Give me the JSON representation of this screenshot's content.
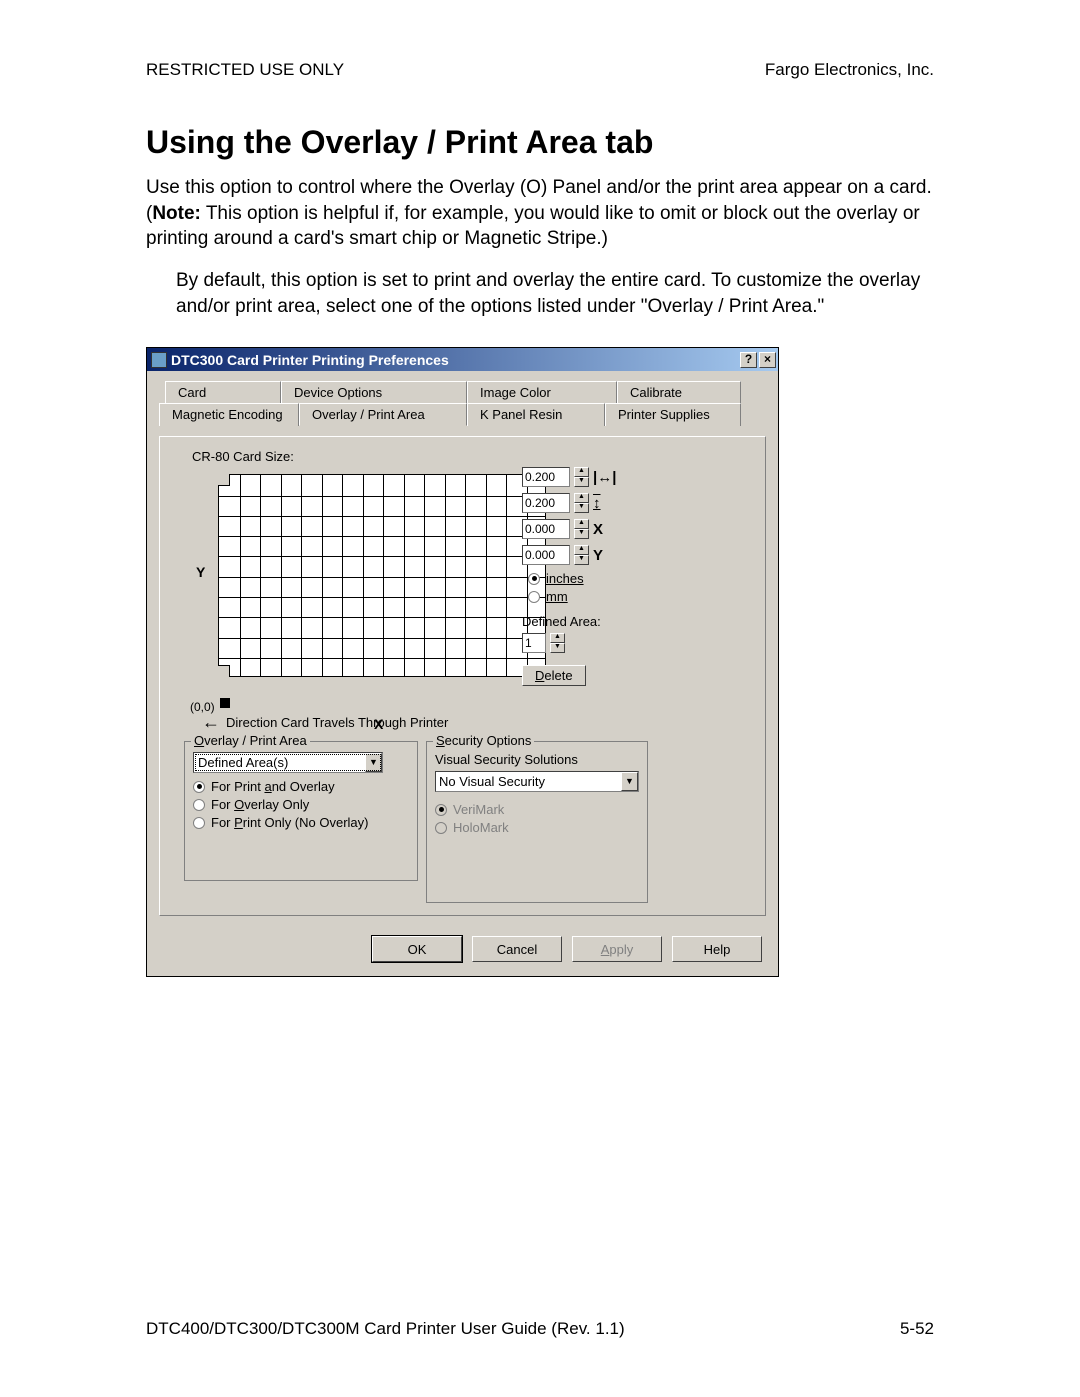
{
  "header": {
    "left": "RESTRICTED USE ONLY",
    "right": "Fargo Electronics, Inc."
  },
  "title": "Using the Overlay / Print Area tab",
  "para1_a": "Use this option to control where the Overlay (O) Panel and/or the print area appear on a card. (",
  "para1_note": "Note:",
  "para1_b": "  This option is helpful if, for example, you would like to omit or block out the overlay or printing around a card's smart chip or Magnetic Stripe.)",
  "para2": "By default, this option is set to print and overlay the entire card. To customize the overlay and/or print area, select one of the options listed under \"Overlay / Print Area.\"",
  "dialog": {
    "title": "DTC300 Card Printer Printing Preferences",
    "help_btn": "?",
    "close_btn": "×",
    "tabs_back": [
      "Card",
      "Device Options",
      "Image Color",
      "Calibrate"
    ],
    "tabs_front": [
      "Magnetic Encoding",
      "Overlay / Print Area",
      "K Panel Resin",
      "Printer Supplies"
    ],
    "active_tab": "Overlay / Print Area",
    "card_size_label": "CR-80 Card Size:",
    "y_axis": "Y",
    "x_axis": "X",
    "origin": "(0,0)",
    "direction": "Direction Card Travels Through Printer",
    "spinners": [
      {
        "value": "0.200",
        "icon": "↔"
      },
      {
        "value": "0.200",
        "icon": "↕"
      },
      {
        "value": "0.000",
        "icon": "X"
      },
      {
        "value": "0.000",
        "icon": "Y"
      }
    ],
    "units": {
      "inches": "inches",
      "mm": "mm"
    },
    "units_selected": "inches",
    "defined_area_label": "Defined Area:",
    "defined_area_value": "1",
    "delete_btn": "Delete",
    "overlay_group": {
      "title": "Overlay / Print Area",
      "combo": "Defined Area(s)",
      "options": [
        {
          "label": "For Print and Overlay",
          "checked": true,
          "u": "a"
        },
        {
          "label": "For Overlay Only",
          "checked": false,
          "u": "O"
        },
        {
          "label": "For Print Only (No Overlay)",
          "checked": false,
          "u": "P"
        }
      ]
    },
    "security_group": {
      "title": "Security Options",
      "vss_label": "Visual Security Solutions",
      "combo": "No Visual Security",
      "verimark": "VeriMark",
      "holomark": "HoloMark"
    },
    "buttons": {
      "ok": "OK",
      "cancel": "Cancel",
      "apply": "Apply",
      "help": "Help"
    }
  },
  "footer": {
    "left": "DTC400/DTC300/DTC300M Card Printer User Guide (Rev. 1.1)",
    "right": "5-52"
  }
}
